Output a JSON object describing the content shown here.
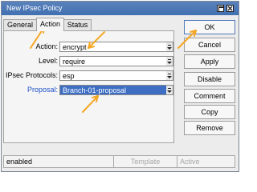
{
  "window": {
    "title": "New IPsec Policy"
  },
  "tabs": [
    {
      "label": "General"
    },
    {
      "label": "Action"
    },
    {
      "label": "Status"
    }
  ],
  "form": {
    "action": {
      "label": "Action:",
      "value": "encrypt"
    },
    "level": {
      "label": "Level:",
      "value": "require"
    },
    "protocols": {
      "label": "IPsec Protocols:",
      "value": "esp"
    },
    "proposal": {
      "label": "Proposal:",
      "value": "Branch-01-proposal"
    }
  },
  "buttons": {
    "ok": "OK",
    "cancel": "Cancel",
    "apply": "Apply",
    "disable": "Disable",
    "comment": "Comment",
    "copy": "Copy",
    "remove": "Remove"
  },
  "status_bar": {
    "state": "enabled",
    "template": "Template",
    "active": "Active"
  },
  "colors": {
    "titlebar": "#4a78b8",
    "selection": "#3d6ec4",
    "proposal_label": "#1e50c8",
    "annotation_arrow": "#f5a623"
  }
}
